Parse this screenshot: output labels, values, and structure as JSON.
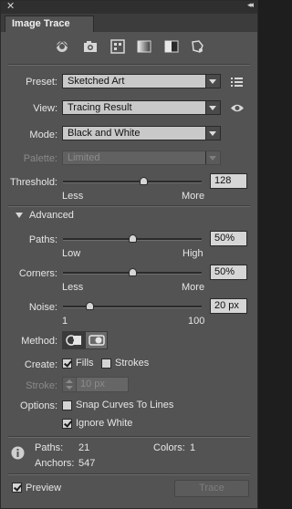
{
  "window": {
    "close_glyph": "✕",
    "collapse_glyph": "◂◂"
  },
  "tab": {
    "title": "Image Trace"
  },
  "preset_icons": [
    "auto-color-icon",
    "high-color-icon",
    "low-color-icon",
    "grayscale-icon",
    "black-and-white-icon",
    "outline-icon"
  ],
  "preset": {
    "label": "Preset:",
    "value": "Sketched Art"
  },
  "view": {
    "label": "View:",
    "value": "Tracing Result"
  },
  "mode": {
    "label": "Mode:",
    "value": "Black and White"
  },
  "palette": {
    "label": "Palette:",
    "value": "Limited"
  },
  "threshold": {
    "label": "Threshold:",
    "value": "128",
    "min_label": "Less",
    "max_label": "More",
    "level": 0.58
  },
  "advanced": {
    "label": "Advanced"
  },
  "paths": {
    "label": "Paths:",
    "value": "50%",
    "min_label": "Low",
    "max_label": "High",
    "level": 0.5
  },
  "corners": {
    "label": "Corners:",
    "value": "50%",
    "min_label": "Less",
    "max_label": "More",
    "level": 0.5
  },
  "noise": {
    "label": "Noise:",
    "value": "20 px",
    "min_label": "1",
    "max_label": "100",
    "level": 0.19
  },
  "method": {
    "label": "Method:"
  },
  "create": {
    "label": "Create:",
    "fills_label": "Fills",
    "strokes_label": "Strokes",
    "fills_checked": true,
    "strokes_checked": false
  },
  "stroke": {
    "label": "Stroke:",
    "value": "10 px"
  },
  "options": {
    "label": "Options:",
    "snap_label": "Snap Curves To Lines",
    "ignore_white_label": "Ignore White",
    "snap_checked": false,
    "ignore_white_checked": true
  },
  "stats": {
    "paths_label": "Paths:",
    "paths_value": "21",
    "colors_label": "Colors:",
    "colors_value": "1",
    "anchors_label": "Anchors:",
    "anchors_value": "547"
  },
  "preview": {
    "label": "Preview",
    "checked": true
  },
  "trace_button": {
    "label": "Trace"
  }
}
